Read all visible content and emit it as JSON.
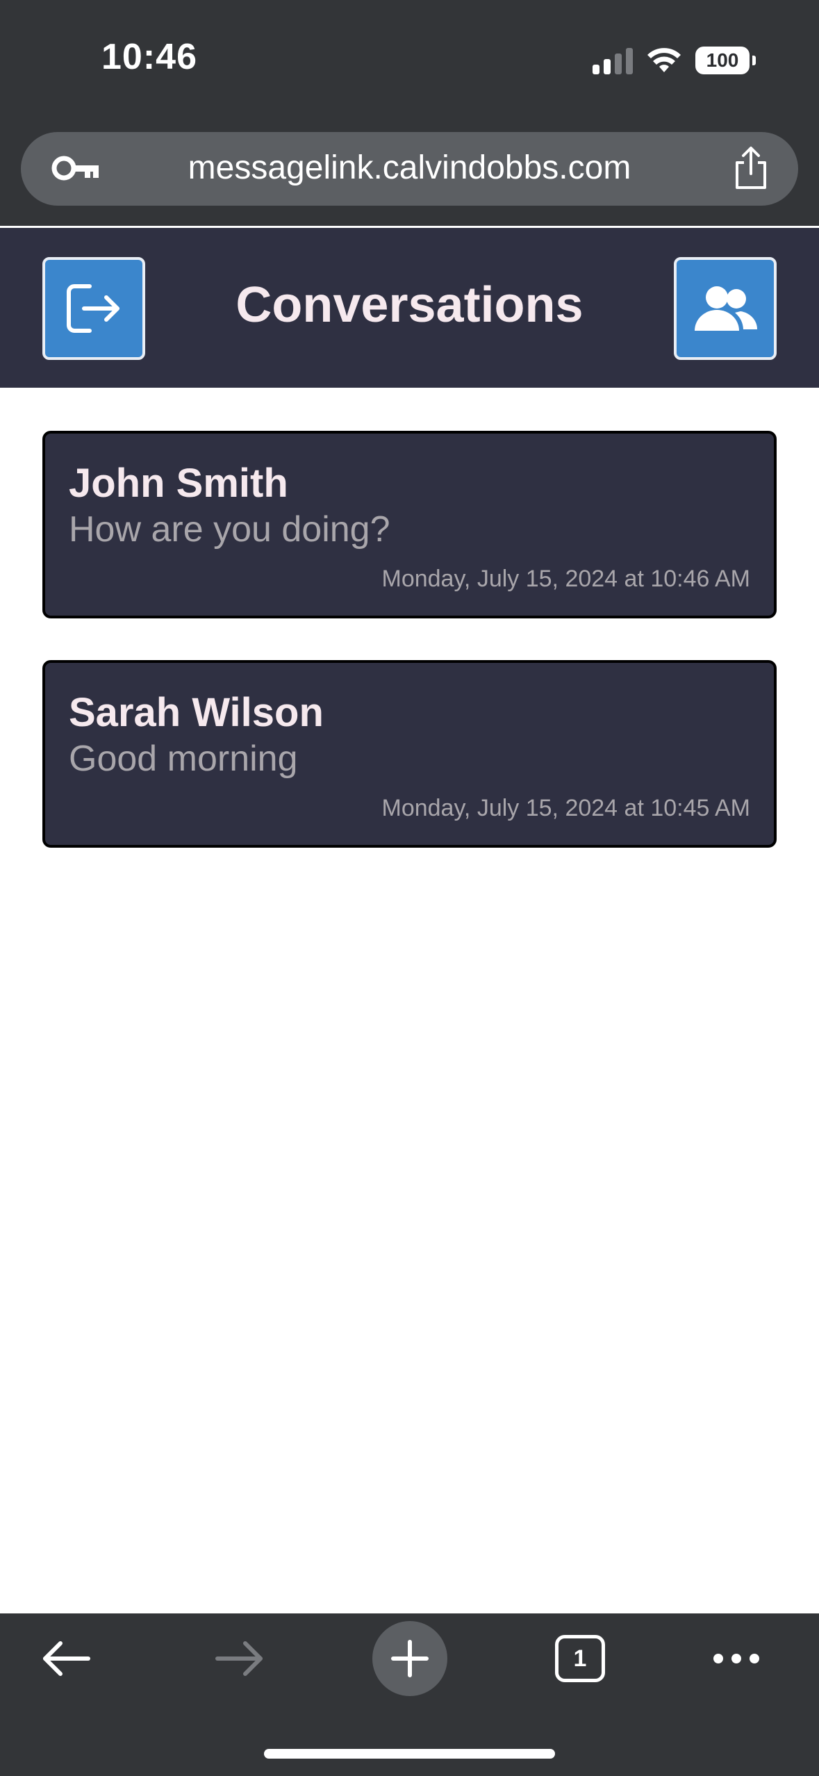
{
  "status_bar": {
    "time": "10:46",
    "battery": "100"
  },
  "browser": {
    "url": "messagelink.calvindobbs.com",
    "tab_count": "1"
  },
  "header": {
    "title": "Conversations"
  },
  "conversations": [
    {
      "name": "John Smith",
      "last_message": "How are you doing?",
      "timestamp": "Monday, July 15, 2024 at 10:46 AM"
    },
    {
      "name": "Sarah Wilson",
      "last_message": "Good morning",
      "timestamp": "Monday, July 15, 2024 at 10:45 AM"
    }
  ],
  "colors": {
    "header_bg": "#2f3042",
    "button_blue": "#3b86cc",
    "title_text": "#f6e9ee",
    "secondary_text": "#a9a6ab",
    "chrome_bg": "#333538"
  },
  "icons": {
    "logout": "logout-icon",
    "contacts": "users-icon",
    "key": "key-icon",
    "share": "share-icon",
    "back": "arrow-left-icon",
    "forward": "arrow-right-icon",
    "new_tab": "plus-icon",
    "tabs": "tabs-icon",
    "more": "more-icon"
  }
}
